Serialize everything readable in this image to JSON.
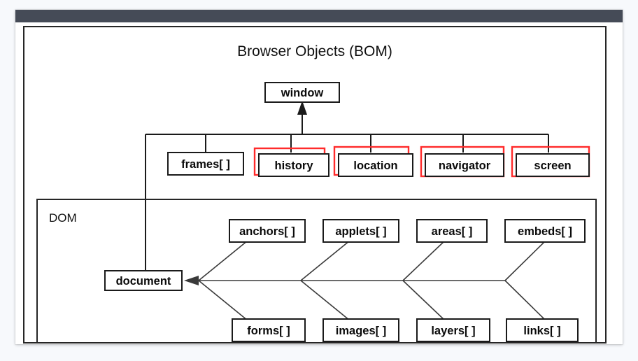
{
  "window": {
    "titlebar_color": "#454b57",
    "card_background": "#ffffff",
    "page_background": "#f7f9fc"
  },
  "diagram": {
    "title": "Browser Objects (BOM)",
    "dom_group_label": "DOM",
    "highlight_color": "#ff2b2b",
    "line_color": "#1a1a1a",
    "root": {
      "label": "window"
    },
    "bom_nodes": [
      {
        "label": "frames[ ]",
        "highlighted": false
      },
      {
        "label": "history",
        "highlighted": true
      },
      {
        "label": "location",
        "highlighted": true
      },
      {
        "label": "navigator",
        "highlighted": true
      },
      {
        "label": "screen",
        "highlighted": true
      }
    ],
    "document_node": {
      "label": "document"
    },
    "dom_top_row": [
      {
        "label": "anchors[ ]"
      },
      {
        "label": "applets[ ]"
      },
      {
        "label": "areas[ ]"
      },
      {
        "label": "embeds[ ]"
      }
    ],
    "dom_bottom_row": [
      {
        "label": "forms[ ]"
      },
      {
        "label": "images[ ]"
      },
      {
        "label": "layers[ ]"
      },
      {
        "label": "links[ ]"
      }
    ]
  }
}
